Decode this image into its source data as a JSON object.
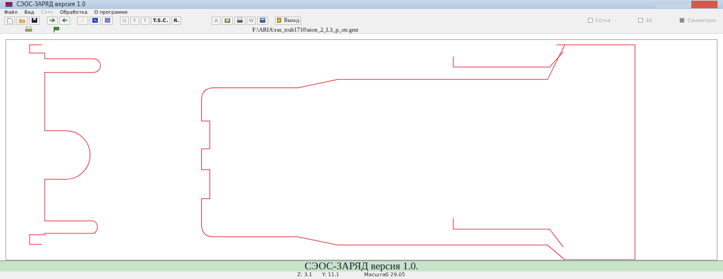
{
  "window": {
    "title": "СЭОС-ЗАРЯД версия 1.0"
  },
  "menu": [
    {
      "label": "Файл",
      "disabled": false
    },
    {
      "label": "Вид",
      "disabled": false
    },
    {
      "label": "Сетч",
      "disabled": true
    },
    {
      "label": "Обработка",
      "disabled": false
    },
    {
      "label": "О программе",
      "disabled": false
    }
  ],
  "toolbar": [
    {
      "kind": "icon",
      "disabled": false
    },
    {
      "kind": "icon",
      "disabled": false
    },
    {
      "kind": "icon",
      "disabled": false
    },
    {
      "kind": "sep"
    },
    {
      "kind": "icon",
      "disabled": false
    },
    {
      "kind": "icon",
      "disabled": false
    },
    {
      "kind": "sep"
    },
    {
      "kind": "icon",
      "disabled": true
    },
    {
      "kind": "icon",
      "disabled": false
    },
    {
      "kind": "icon",
      "disabled": false
    },
    {
      "kind": "sep"
    },
    {
      "kind": "text",
      "label": "U",
      "disabled": true
    },
    {
      "kind": "text",
      "label": "F",
      "disabled": true
    },
    {
      "kind": "text",
      "label": "T",
      "disabled": true
    },
    {
      "kind": "text",
      "label": "T.S.C.",
      "disabled": false
    },
    {
      "kind": "text",
      "label": "R.",
      "disabled": false
    },
    {
      "kind": "gap"
    },
    {
      "kind": "text",
      "label": "A",
      "disabled": true
    },
    {
      "kind": "icon",
      "disabled": false
    },
    {
      "kind": "icon",
      "disabled": false
    },
    {
      "kind": "text",
      "label": "W",
      "disabled": true
    },
    {
      "kind": "icon",
      "disabled": false
    },
    {
      "kind": "sep"
    },
    {
      "kind": "exit",
      "label": "Выход",
      "disabled": false
    }
  ],
  "options": [
    {
      "label": "Сетка",
      "checked": false
    },
    {
      "label": "3D",
      "checked": false
    },
    {
      "label": "Симметрия",
      "checked": true
    }
  ],
  "file_path": "F:\\ARIA\\ras_trub1710\\aion_2_L3_p_otr.gmt",
  "footer": {
    "title": "СЭОС-ЗАРЯД версия 1.0.",
    "status": [
      "Z: 3.1",
      "Y: 11.1",
      "Масштаб 29.05"
    ]
  }
}
